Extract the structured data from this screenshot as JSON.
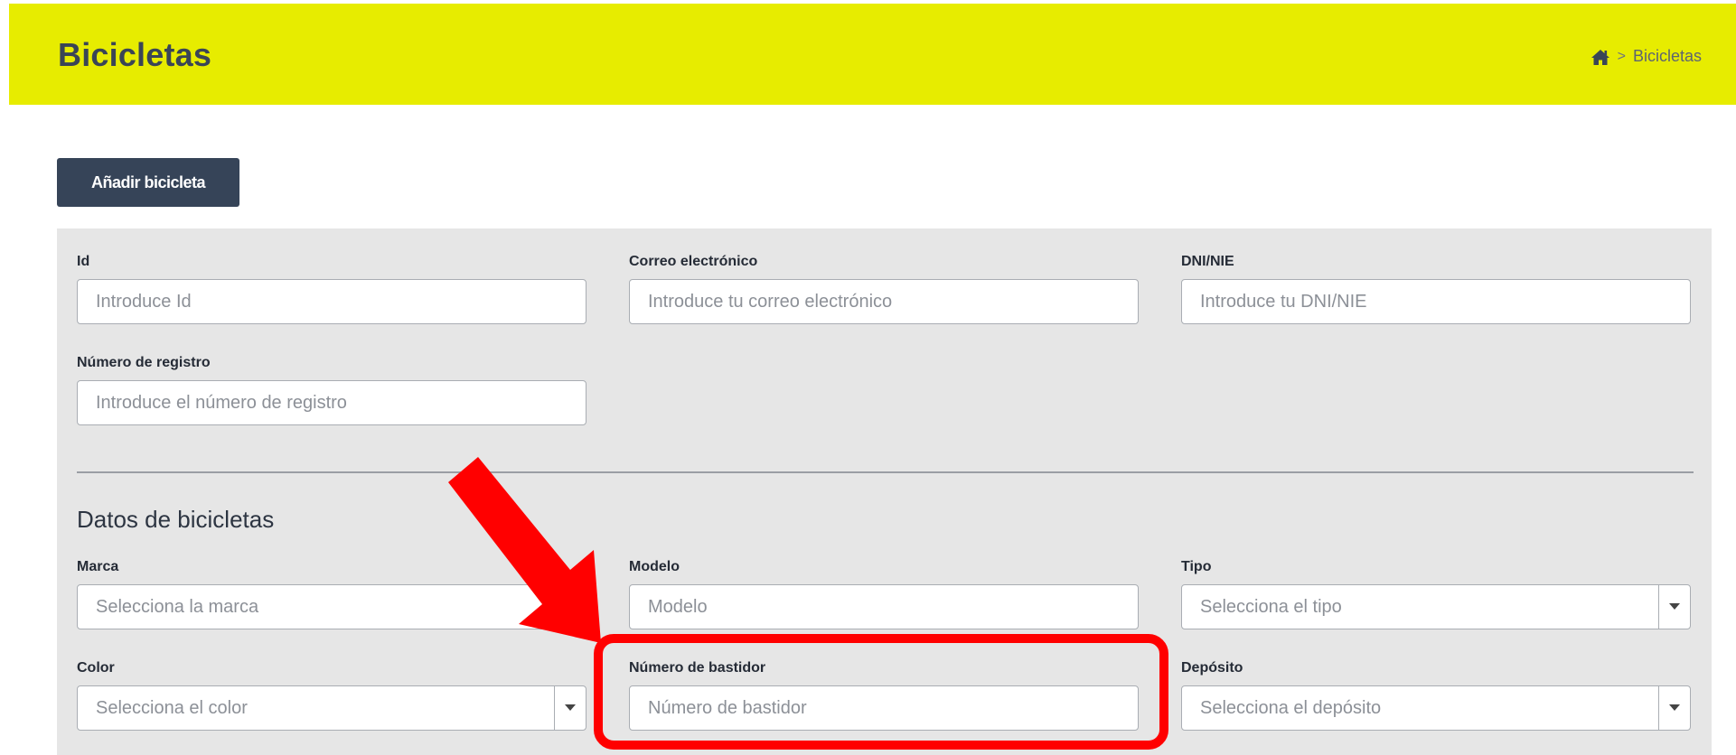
{
  "header": {
    "title": "Bicicletas",
    "breadcrumb": {
      "home_icon": "home-icon",
      "separator": ">",
      "current": "Bicicletas"
    }
  },
  "toolbar": {
    "add_label": "Añadir bicicleta"
  },
  "filters": {
    "id": {
      "label": "Id",
      "placeholder": "Introduce Id"
    },
    "email": {
      "label": "Correo electrónico",
      "placeholder": "Introduce tu correo electrónico"
    },
    "dni": {
      "label": "DNI/NIE",
      "placeholder": "Introduce tu DNI/NIE"
    },
    "registro": {
      "label": "Número de registro",
      "placeholder": "Introduce el número de registro"
    }
  },
  "bike_section": {
    "title": "Datos de bicicletas",
    "marca": {
      "label": "Marca",
      "placeholder": "Selecciona la marca"
    },
    "modelo": {
      "label": "Modelo",
      "placeholder": "Modelo"
    },
    "tipo": {
      "label": "Tipo",
      "value": "Selecciona el tipo"
    },
    "color": {
      "label": "Color",
      "value": "Selecciona el color"
    },
    "bastidor": {
      "label": "Número de bastidor",
      "placeholder": "Número de bastidor"
    },
    "deposito": {
      "label": "Depósito",
      "value": "Selecciona el depósito"
    }
  },
  "colors": {
    "header_bg": "#e7ec00",
    "title_text": "#3a4556",
    "button_bg": "#364458",
    "panel_bg": "#e6e6e6",
    "annotation": "#ff0000"
  },
  "annotation": {
    "shape": "arrow",
    "target": "bastidor-field"
  }
}
